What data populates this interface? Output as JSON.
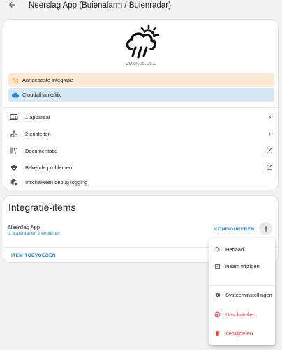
{
  "header": {
    "back_icon": "arrow-left-icon",
    "title": "Neerslag App (Buienalarm / Buienradar)"
  },
  "integration": {
    "logo_icon": "weather-rain-cloud-sun-icon",
    "version": "2024.05.05.0",
    "banners": {
      "custom": {
        "label": "Aangepaste integratie",
        "icon": "package-icon",
        "icon_color": "#f4a035",
        "bg": "#fde9d3"
      },
      "cloud": {
        "label": "Cloudafhankelijk",
        "icon": "cloud-icon",
        "icon_color": "#1e88e5",
        "bg": "#d6eaf6"
      }
    },
    "rows": [
      {
        "label": "1 apparaat",
        "icon": "devices-icon",
        "trailing": "chevron-right-icon"
      },
      {
        "label": "2 entiteiten",
        "icon": "shapes-icon",
        "trailing": "chevron-right-icon"
      },
      {
        "label": "Documentatie",
        "icon": "book-icon",
        "trailing": "open-in-new-icon"
      },
      {
        "label": "Bekende problemen",
        "icon": "bug-icon",
        "trailing": "open-in-new-icon"
      },
      {
        "label": "Inschakelen debug logging",
        "icon": "bug-play-icon",
        "trailing": ""
      }
    ]
  },
  "items_card": {
    "title": "Integratie-items",
    "entry": {
      "name": "Neerslag App",
      "sub": "1 apparaat en 2 entiteiten",
      "configure_label": "CONFIGUREREN",
      "kebab_icon": "dots-vertical-icon"
    },
    "add_label": "ITEM TOEVOEGEN"
  },
  "menu": {
    "items": [
      {
        "label": "Herlaad",
        "icon": "reload-icon",
        "color": "#212121"
      },
      {
        "label": "Naam wijzigen",
        "icon": "rename-icon",
        "color": "#212121"
      },
      {
        "label": "Systeeminstellingen",
        "icon": "cog-icon",
        "color": "#212121"
      },
      {
        "label": "Uitschakelen",
        "icon": "stop-circle-icon",
        "color": "#e53935"
      },
      {
        "label": "Verwijderen",
        "icon": "delete-icon",
        "color": "#e53935"
      }
    ]
  },
  "colors": {
    "accent": "#1e88e5",
    "danger": "#e53935",
    "page_bg": "#f2f2f2"
  }
}
